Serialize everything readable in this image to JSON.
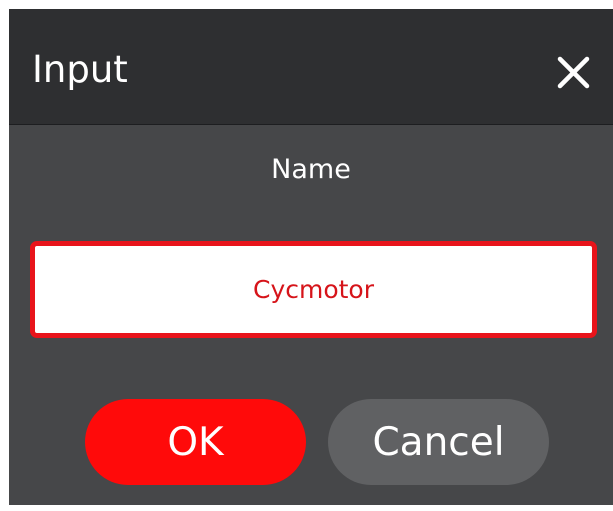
{
  "dialog": {
    "title": "Input",
    "close_icon": "close-icon",
    "field_label": "Name",
    "input_value": "Cycmotor",
    "ok_label": "OK",
    "cancel_label": "Cancel"
  },
  "colors": {
    "header_bg": "#2e2f31",
    "body_bg": "#464749",
    "accent_red": "#ff0a0a",
    "input_border": "#e8141b",
    "input_text": "#d6141a",
    "cancel_bg": "#606163"
  }
}
